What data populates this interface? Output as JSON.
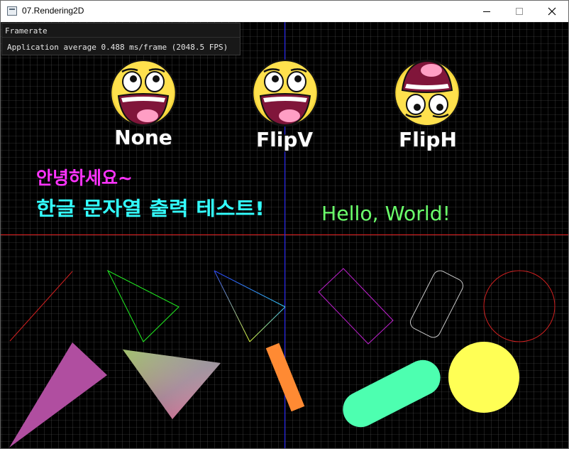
{
  "window": {
    "title": "07.Rendering2D",
    "icons": {
      "app": "app-window-icon",
      "minimize": "minimize-icon",
      "maximize": "maximize-icon",
      "close": "close-icon"
    }
  },
  "overlay": {
    "title": "Framerate",
    "stats": "Application average 0.488 ms/frame (2048.5 FPS)"
  },
  "sprites": [
    {
      "caption": "None",
      "icon": "awesome-smiley-icon"
    },
    {
      "caption": "FlipV",
      "icon": "awesome-smiley-icon"
    },
    {
      "caption": "FlipH",
      "icon": "awesome-smiley-icon-flipped"
    }
  ],
  "text": {
    "korean_line1": "안녕하세요~",
    "korean_line2": "한글 문자열 출력 테스트!",
    "english": "Hello, World!"
  },
  "colors": {
    "grid": "#5a5a5a",
    "axis_x": "#e02020",
    "axis_y": "#2020ff",
    "korean_line1": "#ff33ff",
    "korean_line2": "#33ffff",
    "english": "#6bff6b",
    "face": "#ffe14d",
    "mouth": "#80153a",
    "tongue": "#ff9ec4"
  }
}
